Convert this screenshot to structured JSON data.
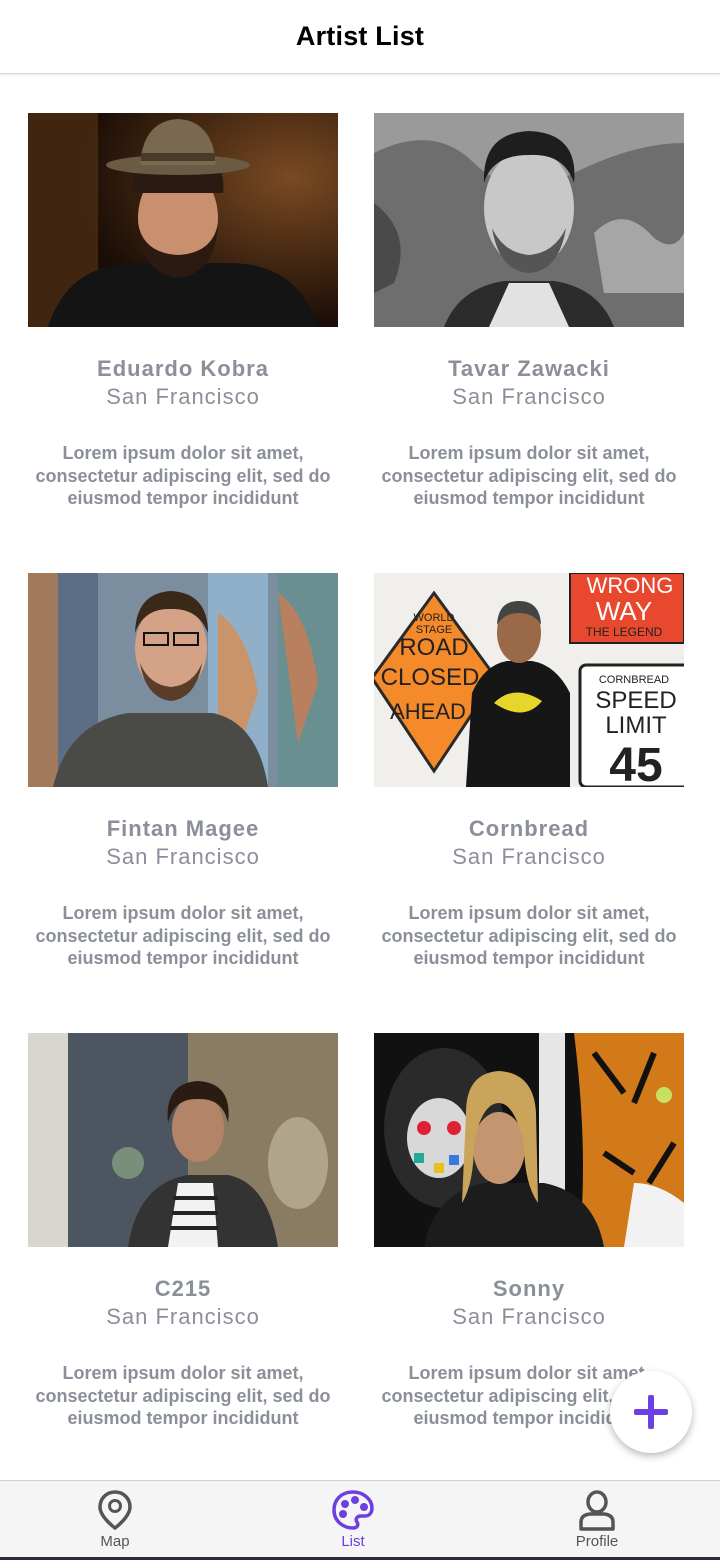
{
  "header": {
    "title": "Artist List"
  },
  "artists": [
    {
      "name": "Eduardo Kobra",
      "city": "San Francisco",
      "description": "Lorem ipsum dolor sit amet, consectetur adipiscing elit, sed do eiusmod tempor incididunt"
    },
    {
      "name": "Tavar Zawacki",
      "city": "San Francisco",
      "description": "Lorem ipsum dolor sit amet, consectetur adipiscing elit, sed do eiusmod tempor incididunt"
    },
    {
      "name": "Fintan Magee",
      "city": "San Francisco",
      "description": "Lorem ipsum dolor sit amet, consectetur adipiscing elit, sed do eiusmod tempor incididunt"
    },
    {
      "name": "Cornbread",
      "city": "San Francisco",
      "description": "Lorem ipsum dolor sit amet, consectetur adipiscing elit, sed do eiusmod tempor incididunt"
    },
    {
      "name": "C215",
      "city": "San Francisco",
      "description": "Lorem ipsum dolor sit amet, consectetur adipiscing elit, sed do eiusmod tempor incididunt"
    },
    {
      "name": "Sonny",
      "city": "San Francisco",
      "description": "Lorem ipsum dolor sit amet, consectetur adipiscing elit, sed do eiusmod tempor incididunt"
    }
  ],
  "photo_signs": {
    "road_sign": [
      "WORLD",
      "STAGE",
      "ROAD",
      "CLOSED",
      "AHEAD"
    ],
    "wrong_way": [
      "WRONG",
      "WAY",
      "THE LEGEND"
    ],
    "speed_limit": [
      "CORNBREAD",
      "SPEED",
      "LIMIT",
      "45"
    ]
  },
  "fab": {
    "icon": "plus-icon",
    "color": "#6d3fe0"
  },
  "tabs": [
    {
      "label": "Map",
      "icon": "map-pin-icon",
      "active": false
    },
    {
      "label": "List",
      "icon": "palette-icon",
      "active": true
    },
    {
      "label": "Profile",
      "icon": "user-icon",
      "active": false
    }
  ],
  "colors": {
    "accent": "#6d3fe0",
    "text_muted": "#8a8f99",
    "tab_inactive": "#555555"
  }
}
